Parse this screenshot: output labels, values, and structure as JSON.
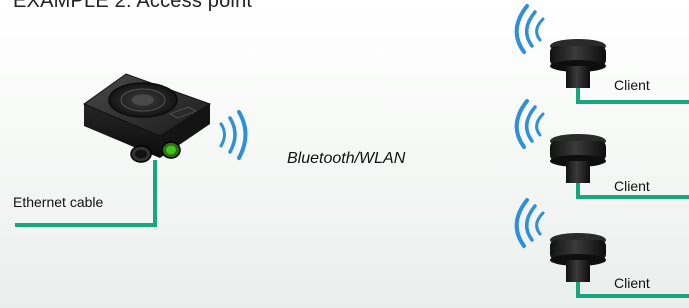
{
  "title": "EXAMPLE 2: Access point",
  "cable_label": "Ethernet cable",
  "link_label": "Bluetooth/WLAN",
  "clients": [
    {
      "label": "Client"
    },
    {
      "label": "Client"
    },
    {
      "label": "Client"
    }
  ],
  "colors": {
    "cable": "#1aa67c",
    "wireless": "#2f8fd9",
    "device": "#1d1d1d",
    "status_led": "#44c21b"
  },
  "icons": {
    "access_point": "access-point-device",
    "client": "antenna-client-device",
    "wireless": "wifi-waves"
  }
}
